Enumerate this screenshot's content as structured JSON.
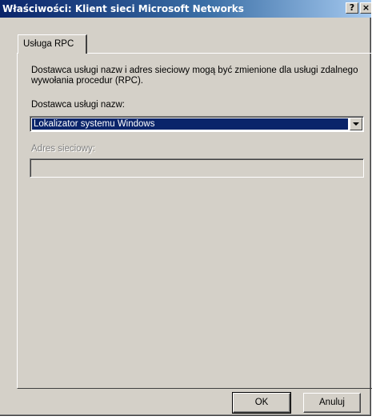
{
  "window": {
    "title": "Właściwości: Klient sieci Microsoft Networks",
    "help_glyph": "?",
    "close_glyph": "×"
  },
  "tabs": [
    {
      "label": "Usługa RPC",
      "selected": true
    }
  ],
  "panel": {
    "description": "Dostawca usługi nazw i adres sieciowy mogą być zmienione dla usługi zdalnego wywołania procedur (RPC).",
    "provider_label": "Dostawca usługi nazw:",
    "provider_value": "Lokalizator systemu Windows",
    "address_label": "Adres sieciowy:",
    "address_value": ""
  },
  "buttons": {
    "ok": "OK",
    "cancel": "Anuluj"
  },
  "icons": {
    "combo_arrow": "chevron-down-icon",
    "help": "help-icon",
    "close": "close-icon"
  },
  "colors": {
    "titlebar_start": "#0a246a",
    "titlebar_end": "#a6caf0",
    "face": "#d4d0c8",
    "selection": "#0a246a"
  }
}
